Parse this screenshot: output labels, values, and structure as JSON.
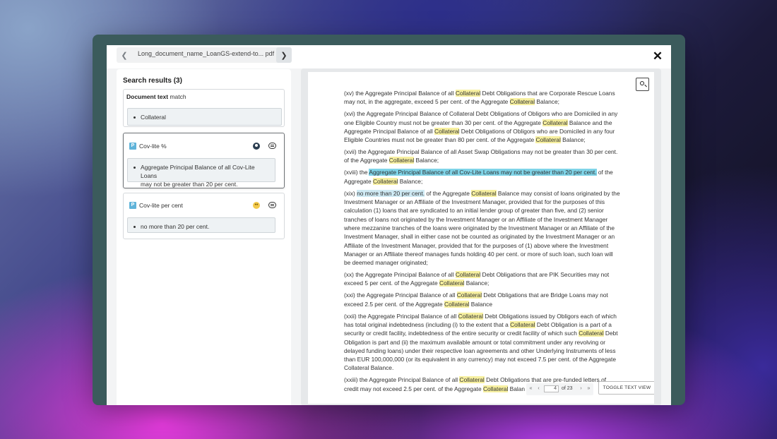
{
  "header": {
    "document_name": "Long_document_name_LoanGS-extend-to... pdf",
    "prev_icon": "chevron-left-icon",
    "next_icon": "chevron-right-icon",
    "close_icon": "close-icon"
  },
  "search": {
    "results_title": "Search results (3)",
    "results": [
      {
        "kind_label": "Document text",
        "match_label": "match",
        "snippet": "Collateral"
      },
      {
        "badge": "P",
        "title": "Cov-lite %",
        "snippet_line1": "Aggregate Principal Balance of all Cov-Lite Loans",
        "snippet_line2": "may not be greater than 20 per cent."
      },
      {
        "badge": "P",
        "title": "Cov-lite per cent",
        "snippet": "no more than 20 per cent."
      }
    ]
  },
  "viewer": {
    "current_page": "4",
    "page_count_label": "of 23",
    "toggle_label": "TOGGLE TEXT VIEW",
    "search_icon": "search-icon"
  },
  "colors": {
    "highlight_term": "#f7f0a0",
    "highlight_selected": "#7fd4e8",
    "highlight_secondary": "#cfeaf4",
    "window_frame": "#3b5b5c"
  },
  "doc": {
    "p1": {
      "a": "(xv) the Aggregate Principal Balance of all ",
      "b": "Collateral",
      "c": " Debt Obligations that are Corporate Rescue Loans may not, in the aggregate, exceed 5 per cent. of the Aggregate ",
      "d": "Collateral",
      "e": " Balance;"
    },
    "p2": {
      "a": "(xvi) the Aggregate Principal Balance of Collateral Debt Obligations of Obligors who are Domiciled in any one Eligible Country must not be greater than 30 per cent. of the Aggregate ",
      "b": "Collateral",
      "c": " Balance and the Aggregate Principal Balance of all ",
      "d": "Collateral",
      "e": " Debt Obligations of Obligors who are Domiciled in any four Eligible Countries must not be greater than 80 per cent. of the Aggregate ",
      "f": "Collateral",
      "g": " Balance;"
    },
    "p3": {
      "a": "(xvii) the Aggregate Principal Balance of all Asset Swap Obligations may not be greater than 30 per cent. of the Aggregate ",
      "b": "Collateral",
      "c": " Balance;"
    },
    "p4": {
      "a": "(xviii) the ",
      "b": "Aggregate Principal Balance of all Cov-Lite Loans may not be greater than 20 per cent.",
      "c": " of the Aggregate ",
      "d": "Collateral",
      "e": " Balance;"
    },
    "p5": {
      "a": "(xix) ",
      "b": "no more than 20 per cent.",
      "c": " of the Aggregate ",
      "d": "Collateral",
      "e": " Balance may consist of loans originated by the Investment Manager or an Affiliate of the Investment Manager, provided that for the purposes of this calculation (1) loans that are syndicated to an initial lender group of greater than five, and (2) senior tranches of loans not originated by the Investment Manager or an Affiliate of the Investment Manager where mezzanine tranches of the loans were originated by the Investment Manager or an Affiliate of the Investment Manager, shall in either case not be counted as originated by the Investment Manager or an Affiliate of the Investment Manager, provided that for the purposes of (1) above where the Investment Manager or an Affiliate thereof manages funds holding 40 per cent. or more of such loan, such loan will be deemed manager originated;"
    },
    "p6": {
      "a": "(xx) the Aggregate Principal Balance of all ",
      "b": "Collateral",
      "c": " Debt Obligations that are PIK Securities may not exceed 5 per cent. of the Aggregate ",
      "d": "Collateral",
      "e": " Balance;"
    },
    "p7": {
      "a": "(xxi) the Aggregate Principal Balance of all ",
      "b": "Collateral",
      "c": " Debt Obligations that are Bridge Loans may not exceed 2.5 per cent. of the Aggregate ",
      "d": "Collateral",
      "e": " Balance"
    },
    "p8": {
      "a": "(xxii) the Aggregate Principal Balance of all ",
      "b": "Collateral",
      "c": " Debt Obligations issued by Obligors each of which has total original indebtedness (including (i) to the extent that a ",
      "d": "Collateral",
      "e": " Debt Obligation is a part of a security or credit facility, indebtedness of the entire security or credit facility of which such ",
      "f": "Collateral",
      "g": " Debt Obligation is part and (ii) the maximum available amount or total commitment under any revolving or delayed funding loans) under their respective loan agreements and other Underlying Instruments of less than EUR 100,000,000 (or its equivalent in any currency) may not exceed 7.5 per cent. of the Aggregate Collateral Balance."
    },
    "p9": {
      "a": "(xxiii) the Aggregate Principal Balance of all ",
      "b": "Collateral",
      "c": " Debt Obligations that are pre-funded letters of credit may not exceed 2.5 per cent. of the Aggregate ",
      "d": "Collateral",
      "e": " Balan"
    }
  }
}
